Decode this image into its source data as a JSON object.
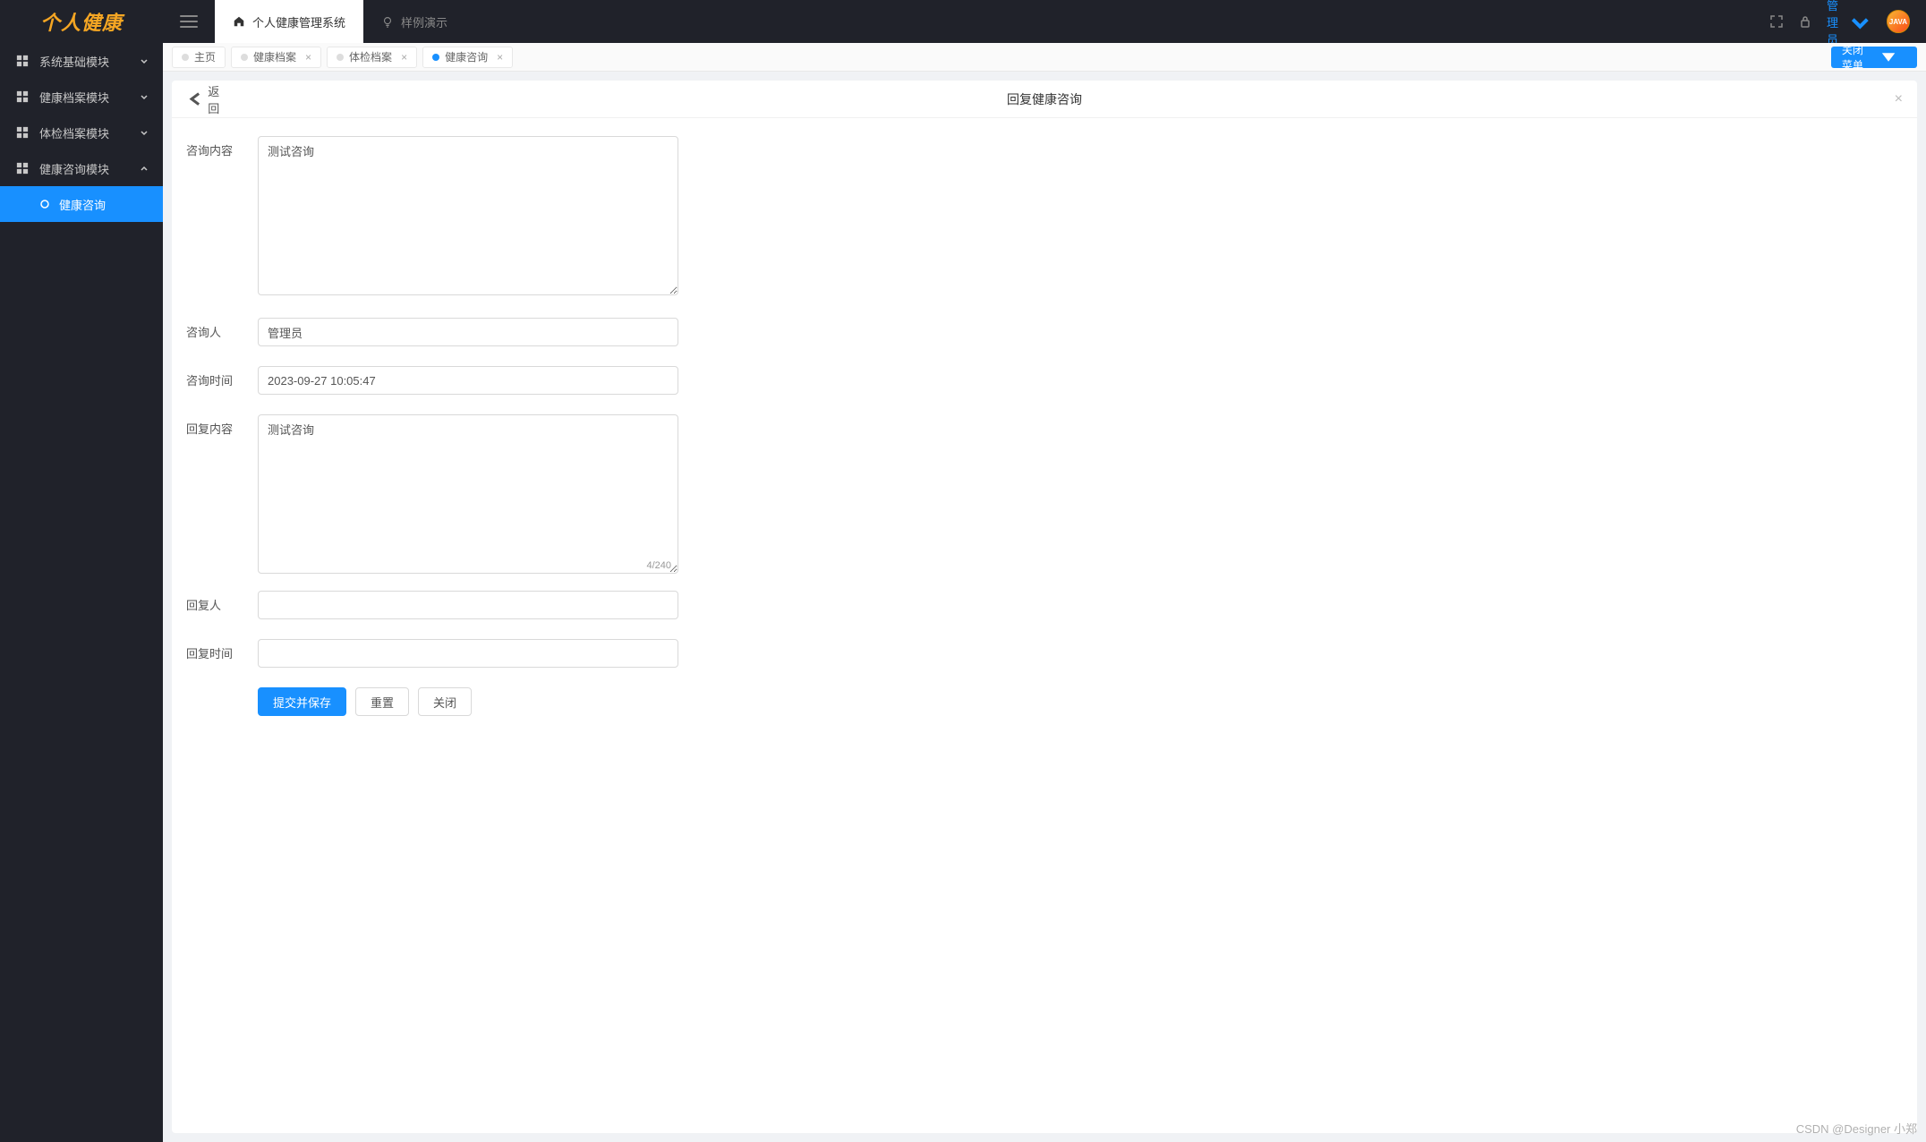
{
  "logo": "个人健康",
  "sidebar": {
    "items": [
      {
        "label": "系统基础模块",
        "expanded": false
      },
      {
        "label": "健康档案模块",
        "expanded": false
      },
      {
        "label": "体检档案模块",
        "expanded": false
      },
      {
        "label": "健康咨询模块",
        "expanded": true
      }
    ],
    "active_sub": "健康咨询"
  },
  "header": {
    "nav": [
      {
        "label": "个人健康管理系统",
        "active": true
      },
      {
        "label": "样例演示",
        "active": false
      }
    ],
    "user": "管理员",
    "avatar_text": "JAVA"
  },
  "tabs": [
    {
      "label": "主页",
      "closable": false,
      "active": false
    },
    {
      "label": "健康档案",
      "closable": true,
      "active": false
    },
    {
      "label": "体检档案",
      "closable": true,
      "active": false
    },
    {
      "label": "健康咨询",
      "closable": true,
      "active": true
    }
  ],
  "close_menu_label": "关闭菜单",
  "panel": {
    "back": "返回",
    "title": "回复健康咨询"
  },
  "form": {
    "labels": {
      "consult_content": "咨询内容",
      "consult_person": "咨询人",
      "consult_time": "咨询时间",
      "reply_content": "回复内容",
      "reply_person": "回复人",
      "reply_time": "回复时间"
    },
    "values": {
      "consult_content": "测试咨询",
      "consult_person": "管理员",
      "consult_time": "2023-09-27 10:05:47",
      "reply_content": "测试咨询",
      "reply_person": "",
      "reply_time": ""
    },
    "reply_char_count": "4/240",
    "buttons": {
      "submit": "提交并保存",
      "reset": "重置",
      "close": "关闭"
    }
  },
  "watermark": "CSDN @Designer 小郑"
}
